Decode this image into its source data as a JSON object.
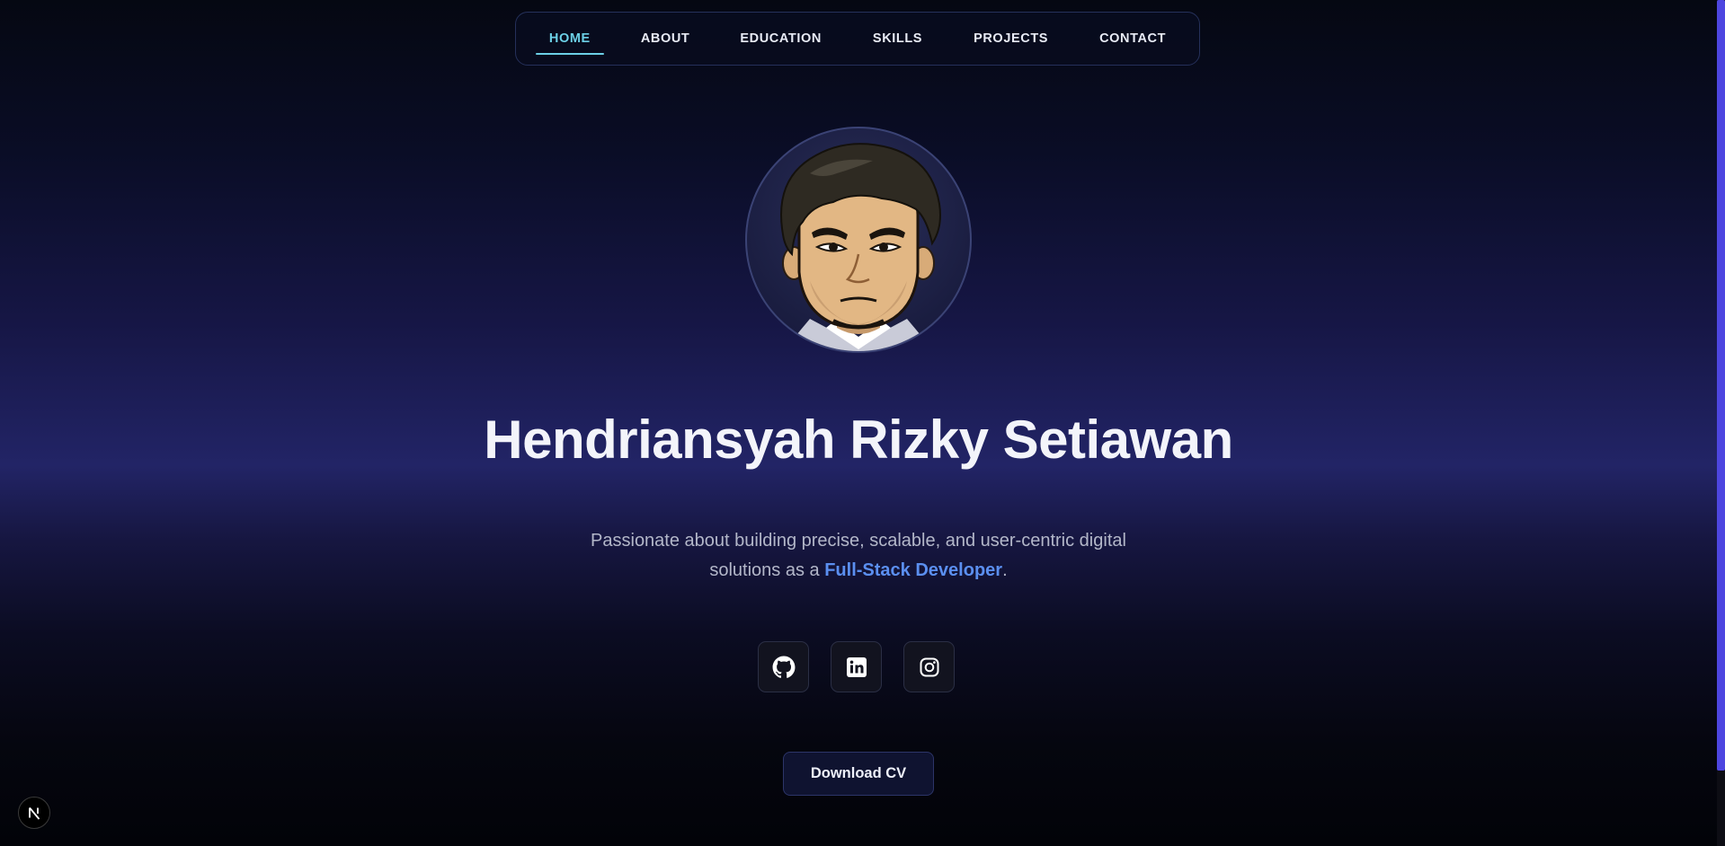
{
  "nav": {
    "items": [
      {
        "label": "HOME",
        "active": true
      },
      {
        "label": "ABOUT",
        "active": false
      },
      {
        "label": "EDUCATION",
        "active": false
      },
      {
        "label": "SKILLS",
        "active": false
      },
      {
        "label": "PROJECTS",
        "active": false
      },
      {
        "label": "CONTACT",
        "active": false
      }
    ]
  },
  "hero": {
    "name": "Hendriansyah Rizky Setiawan",
    "tagline_pre": "Passionate about building precise, scalable, and user-centric digital solutions as a ",
    "tagline_role": "Full-Stack Developer",
    "tagline_post": ".",
    "download_label": "Download CV"
  },
  "socials": [
    {
      "icon": "github-icon"
    },
    {
      "icon": "linkedin-icon"
    },
    {
      "icon": "instagram-icon"
    }
  ],
  "colors": {
    "accent": "#6cd0e6",
    "role": "#5b8ff0",
    "scrollbar": "#4d46e0"
  },
  "dev_indicator": {
    "label": "N"
  }
}
